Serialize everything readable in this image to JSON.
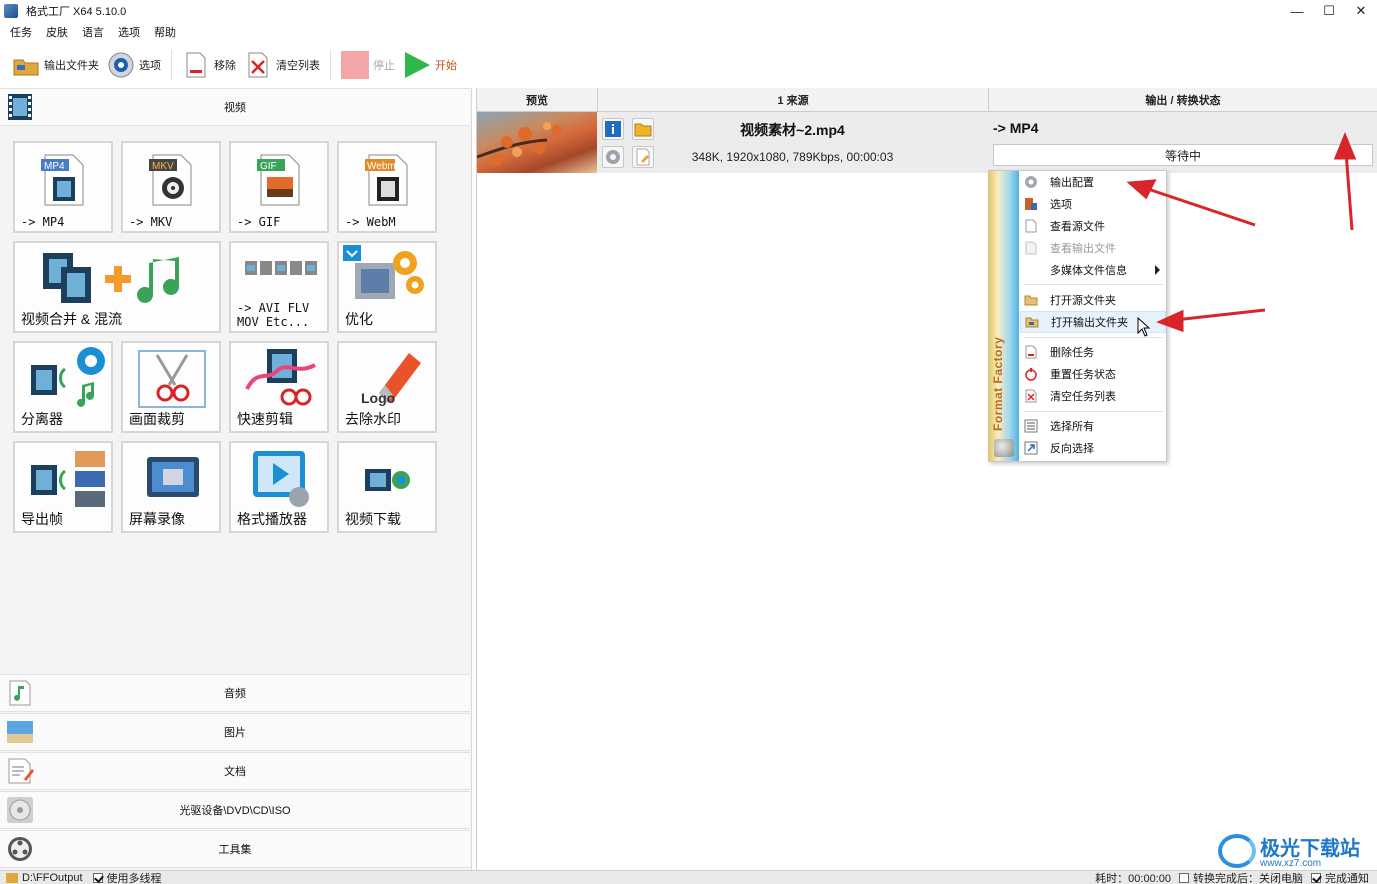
{
  "window": {
    "title": "格式工厂 X64 5.10.0"
  },
  "menu": [
    "任务",
    "皮肤",
    "语言",
    "选项",
    "帮助"
  ],
  "toolbar": {
    "output_folder": "输出文件夹",
    "options": "选项",
    "remove": "移除",
    "clear_list": "清空列表",
    "stop": "停止",
    "start": "开始"
  },
  "left": {
    "video_header": "视频",
    "tiles": [
      {
        "label": "-> MP4",
        "badge": "MP4"
      },
      {
        "label": "-> MKV",
        "badge": "MKV"
      },
      {
        "label": "-> GIF",
        "badge": "GIF"
      },
      {
        "label": "-> WebM",
        "badge": "Webm"
      },
      {
        "label": "视频合并 & 混流"
      },
      {
        "label": "-> AVI FLV\nMOV Etc..."
      },
      {
        "label": "优化"
      },
      {
        "label": "分离器"
      },
      {
        "label": "画面裁剪"
      },
      {
        "label": "快速剪辑"
      },
      {
        "label": "去除水印",
        "logo_text": "Logo"
      },
      {
        "label": "导出帧"
      },
      {
        "label": "屏幕录像"
      },
      {
        "label": "格式播放器"
      },
      {
        "label": "视频下载"
      }
    ],
    "categories": [
      "音频",
      "图片",
      "文档",
      "光驱设备\\DVD\\CD\\ISO",
      "工具集"
    ]
  },
  "table": {
    "headers": [
      "预览",
      "1 来源",
      "输出 / 转换状态"
    ],
    "task": {
      "filename": "视频素材~2.mp4",
      "info": "348K, 1920x1080, 789Kbps, 00:00:03",
      "output": "-> MP4",
      "status": "等待中"
    }
  },
  "context_menu": {
    "brand": "Format Factory",
    "items": [
      {
        "label": "输出配置",
        "icon": "gear-icon"
      },
      {
        "label": "选项",
        "icon": "options-icon"
      },
      {
        "label": "查看源文件",
        "icon": "file-icon"
      },
      {
        "label": "查看输出文件",
        "icon": "file-icon",
        "disabled": true
      },
      {
        "label": "多媒体文件信息",
        "icon": "none",
        "submenu": true
      },
      {
        "label": "打开源文件夹",
        "icon": "folder-icon"
      },
      {
        "label": "打开输出文件夹",
        "icon": "folder-icon",
        "hover": true
      },
      {
        "label": "删除任务",
        "icon": "delete-icon"
      },
      {
        "label": "重置任务状态",
        "icon": "reset-icon"
      },
      {
        "label": "清空任务列表",
        "icon": "clear-icon"
      },
      {
        "label": "选择所有",
        "icon": "select-all-icon"
      },
      {
        "label": "反向选择",
        "icon": "invert-icon"
      }
    ]
  },
  "statusbar": {
    "output_path": "D:\\FFOutput",
    "multithread": "使用多线程",
    "elapsed": "耗时：00:00:00",
    "after_convert": "转换完成后：关闭电脑",
    "notify": "完成通知"
  },
  "watermark": {
    "text": "极光下载站",
    "url": "www.xz7.com"
  },
  "colors": {
    "accent_red": "#d9252a",
    "start_green": "#2fb84a",
    "hover_blue": "#e5f1fb"
  }
}
